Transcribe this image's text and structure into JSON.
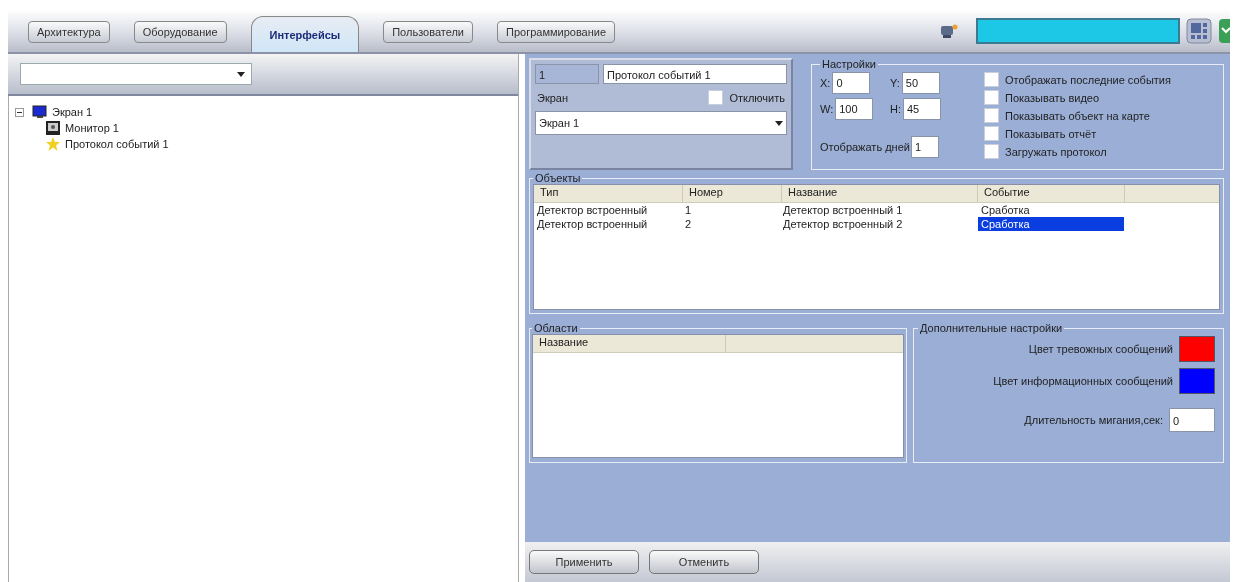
{
  "tabs": [
    {
      "label": "Архитектура",
      "selected": false
    },
    {
      "label": "Оборудование",
      "selected": false
    },
    {
      "label": "Интерфейсы",
      "selected": true
    },
    {
      "label": "Пользователи",
      "selected": false
    },
    {
      "label": "Программирование",
      "selected": false
    }
  ],
  "tree": [
    {
      "label": "Экран 1",
      "kind": "screen",
      "expanded": true,
      "children": [
        {
          "label": "Монитор 1",
          "kind": "monitor"
        },
        {
          "label": "Протокол событий 1",
          "kind": "protocol"
        }
      ]
    }
  ],
  "object": {
    "id": "1",
    "name": "Протокол событий 1",
    "screen_label": "Экран",
    "disable_label": "Отключить",
    "disabled": false,
    "screen_value": "Экран 1"
  },
  "settings": {
    "title": "Настройки",
    "fields": [
      {
        "label": "X:",
        "value": "0"
      },
      {
        "label": "Y:",
        "value": "50"
      },
      {
        "label": "W:",
        "value": "100"
      },
      {
        "label": "H:",
        "value": "45"
      }
    ],
    "days_label": "Отображать дней",
    "days_value": "1",
    "options": [
      {
        "label": "Отображать последние события",
        "checked": false
      },
      {
        "label": "Показывать видео",
        "checked": false
      },
      {
        "label": "Показывать объект на карте",
        "checked": false
      },
      {
        "label": "Показывать отчёт",
        "checked": false
      },
      {
        "label": "Загружать протокол",
        "checked": false
      }
    ]
  },
  "objects": {
    "title": "Объекты",
    "columns": [
      "Тип",
      "Номер",
      "Название",
      "Событие"
    ],
    "rows": [
      {
        "cells": [
          "Детектор встроенный",
          "1",
          "Детектор встроенный 1",
          "Сработка"
        ],
        "selected": false
      },
      {
        "cells": [
          "Детектор встроенный",
          "2",
          "Детектор встроенный 2",
          "Сработка"
        ],
        "selected": true
      }
    ]
  },
  "areas": {
    "title": "Области",
    "columns": [
      "Название"
    ]
  },
  "extra": {
    "title": "Дополнительные настройки",
    "colors": [
      {
        "label": "Цвет тревожных сообщений",
        "color": "#ff0000"
      },
      {
        "label": "Цвет информационных сообщений",
        "color": "#0000ff"
      }
    ],
    "blink_label": "Длительность мигания,сек:",
    "blink_value": "0"
  },
  "buttons": [
    "Применить",
    "Отменить"
  ]
}
